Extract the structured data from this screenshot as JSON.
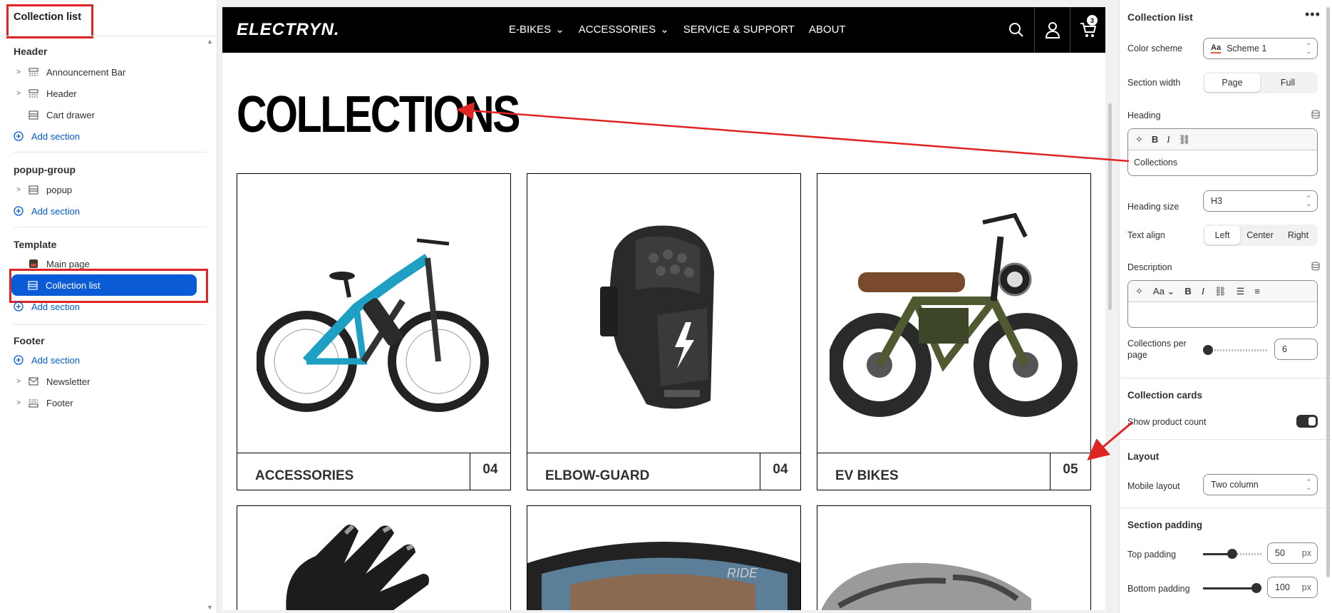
{
  "left": {
    "title": "Collection list",
    "groups": {
      "header": {
        "title": "Header",
        "items": [
          "Announcement Bar",
          "Header",
          "Cart drawer"
        ],
        "add": "Add section"
      },
      "popup": {
        "title": "popup-group",
        "items": [
          "popup"
        ],
        "add": "Add section"
      },
      "template": {
        "title": "Template",
        "items": [
          "Main page",
          "Collection list"
        ],
        "add": "Add section"
      },
      "footer": {
        "title": "Footer",
        "add": "Add section",
        "items": [
          "Newsletter",
          "Footer"
        ]
      }
    }
  },
  "store": {
    "logo": "ELECTRYN.",
    "nav": [
      "E-BIKES",
      "ACCESSORIES",
      "SERVICE & SUPPORT",
      "ABOUT"
    ],
    "cart_count": "3",
    "heading": "COLLECTIONS",
    "collections": [
      {
        "name": "ACCESSORIES",
        "count": "04"
      },
      {
        "name": "ELBOW-GUARD",
        "count": "04"
      },
      {
        "name": "EV BIKES",
        "count": "05"
      }
    ]
  },
  "right": {
    "title": "Collection list",
    "color_scheme": {
      "label": "Color scheme",
      "value": "Scheme 1",
      "swatch": "Aa"
    },
    "section_width": {
      "label": "Section width",
      "options": [
        "Page",
        "Full"
      ],
      "selected": "Page"
    },
    "heading": {
      "label": "Heading",
      "value": "Collections"
    },
    "heading_size": {
      "label": "Heading size",
      "value": "H3"
    },
    "text_align": {
      "label": "Text align",
      "options": [
        "Left",
        "Center",
        "Right"
      ],
      "selected": "Left"
    },
    "description": {
      "label": "Description",
      "font_btn": "Aa"
    },
    "per_page": {
      "label": "Collections per page",
      "value": "6"
    },
    "cards": {
      "heading": "Collection cards",
      "show_count_label": "Show product count",
      "show_count": true
    },
    "layout": {
      "heading": "Layout",
      "mobile_label": "Mobile layout",
      "mobile_value": "Two column"
    },
    "padding": {
      "heading": "Section padding",
      "top_label": "Top padding",
      "top_value": "50",
      "top_unit": "px",
      "bottom_label": "Bottom padding",
      "bottom_value": "100",
      "bottom_unit": "px"
    }
  },
  "colors": {
    "accent": "#0b5bd7",
    "annotation": "#e02424"
  }
}
